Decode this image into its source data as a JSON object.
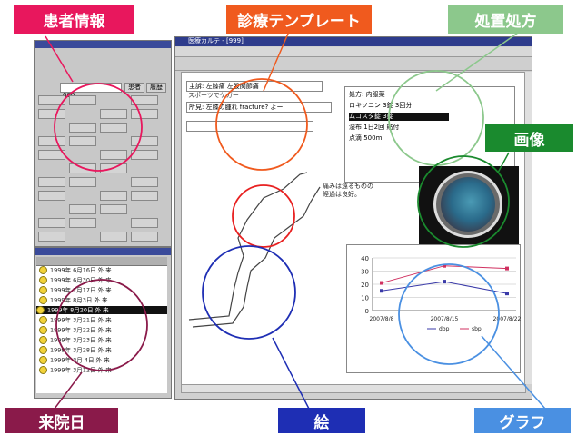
{
  "labels": {
    "patient_info": "患者情報",
    "template": "診療テンプレート",
    "prescription": "処置処方",
    "image": "画像",
    "visit_date": "来院日",
    "drawing": "絵",
    "graph": "グラフ"
  },
  "colors": {
    "patient_info": "#e8175d",
    "template": "#f05a1e",
    "prescription": "#8cc88c",
    "image": "#1a8a2e",
    "visit_date": "#8a1a4a",
    "drawing": "#1e2eb4",
    "graph": "#4a90e2"
  },
  "left_panel": {
    "patient_id_field": "000",
    "btn_a": "患者",
    "btn_b": "履歴"
  },
  "visit_list": {
    "rows": [
      {
        "year": "1999年",
        "date": "6月16日",
        "type": "外 来"
      },
      {
        "year": "1999年",
        "date": "6月30日",
        "type": "外 来"
      },
      {
        "year": "1999年",
        "date": "7月17日",
        "type": "外 来"
      },
      {
        "year": "1999年",
        "date": "8月3日",
        "type": "外 来"
      },
      {
        "year": "1999年",
        "date": "8月20日",
        "type": "外 来"
      },
      {
        "year": "1999年",
        "date": "3月21日",
        "type": "外 来"
      },
      {
        "year": "1999年",
        "date": "3月22日",
        "type": "外 来"
      },
      {
        "year": "1999年",
        "date": "3月23日",
        "type": "外 来"
      },
      {
        "year": "1999年",
        "date": "3月28日",
        "type": "外 来"
      },
      {
        "year": "1999年",
        "date": "3月 4日",
        "type": "外 来"
      },
      {
        "year": "1999年",
        "date": "3月12日",
        "type": "外 来"
      }
    ]
  },
  "main_window": {
    "title": "医療カルテ - [999]",
    "template_lines": [
      "主訴: 左膝痛 左股関節痛",
      "スポーツでケガー",
      "所見: 左膝の腫れ fracture? よー"
    ],
    "drawing_note": "痛みは遠るものの\n経過は良好。"
  },
  "prescription_panel": {
    "lines": [
      "処方: 内服薬",
      "ロキソニン 3錠 3回分",
      "ムコスタ錠 3錠",
      "湿布 1日2回 貼付",
      "点滴 500ml"
    ]
  },
  "chart_data": {
    "type": "line",
    "categories": [
      "2007/8/8",
      "2007/8/15",
      "2007/8/22"
    ],
    "series": [
      {
        "name": "dbp",
        "values": [
          15,
          22,
          13
        ]
      },
      {
        "name": "sbp",
        "values": [
          21,
          34,
          32
        ]
      }
    ],
    "ylim": [
      0,
      40
    ],
    "yticks": [
      0,
      10,
      20,
      30,
      40
    ]
  }
}
